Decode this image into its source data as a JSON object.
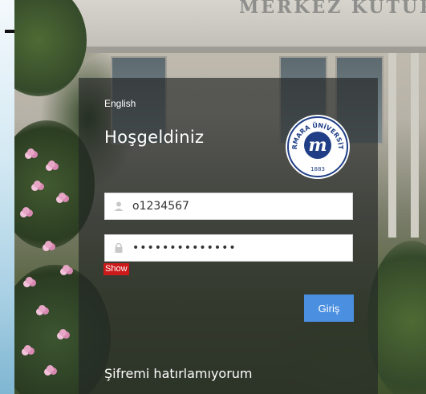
{
  "background": {
    "building_sign": "MERKEZ KÜTÜPHANE"
  },
  "login": {
    "language_link": "English",
    "welcome_text": "Hoşgeldiniz",
    "logo": {
      "ring_text": "MARMARA ÜNİVERSİTESİ",
      "year": "1883",
      "monogram": "m"
    },
    "username": {
      "value": "o1234567",
      "icon": "user-icon"
    },
    "password": {
      "value": "••••••••••••••",
      "icon": "lock-icon"
    },
    "show_label": "Show",
    "submit_label": "Giriş",
    "forgot_label": "Şifremi hatırlamıyorum"
  },
  "colors": {
    "panel": "#232626",
    "submit_button": "#4a8fe0",
    "show_badge": "#cc1a1a",
    "logo_blue": "#1f3e86"
  }
}
